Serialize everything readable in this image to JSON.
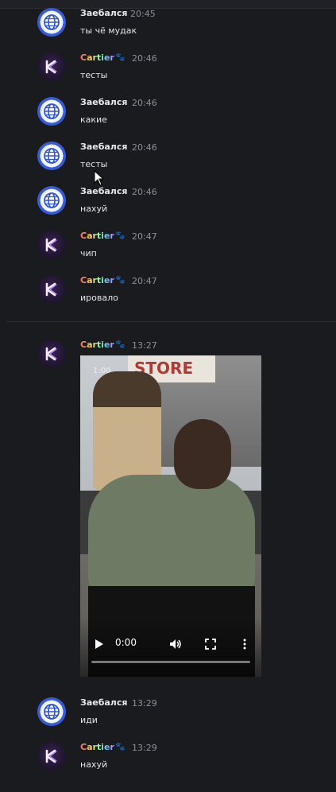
{
  "messages": [
    {
      "author": "Заебался",
      "avatar": "globe-icon",
      "time": "20:45",
      "text": "ты чё мудак"
    },
    {
      "author": "Cartier",
      "avatar": "k-logo-icon",
      "badge": "🐾",
      "time": "20:46",
      "text": "тесты"
    },
    {
      "author": "Заебался",
      "avatar": "globe-icon",
      "time": "20:46",
      "text": "какие"
    },
    {
      "author": "Заебался",
      "avatar": "globe-icon",
      "time": "20:46",
      "text": "тесты"
    },
    {
      "author": "Заебался",
      "avatar": "globe-icon",
      "time": "20:46",
      "text": "нахуй"
    },
    {
      "author": "Cartier",
      "avatar": "k-logo-icon",
      "badge": "🐾",
      "time": "20:47",
      "text": "чип"
    },
    {
      "author": "Cartier",
      "avatar": "k-logo-icon",
      "badge": "🐾",
      "time": "20:47",
      "text": "ировало"
    },
    {
      "author": "Cartier",
      "avatar": "k-logo-icon",
      "badge": "🐾",
      "time": "13:27",
      "text": ""
    },
    {
      "author": "Заебался",
      "avatar": "globe-icon",
      "time": "13:29",
      "text": "иди"
    },
    {
      "author": "Cartier",
      "avatar": "k-logo-icon",
      "badge": "🐾",
      "time": "13:29",
      "text": "нахуй"
    }
  ],
  "video": {
    "sign_text": "STORE",
    "badge_text": "1:00",
    "current_time": "0:00",
    "progress": 0
  },
  "colors": {
    "background": "#1a1b1f",
    "author_default": "#e9e9ec",
    "timestamp": "#8c8f97",
    "message_text": "#e3e4e8"
  }
}
